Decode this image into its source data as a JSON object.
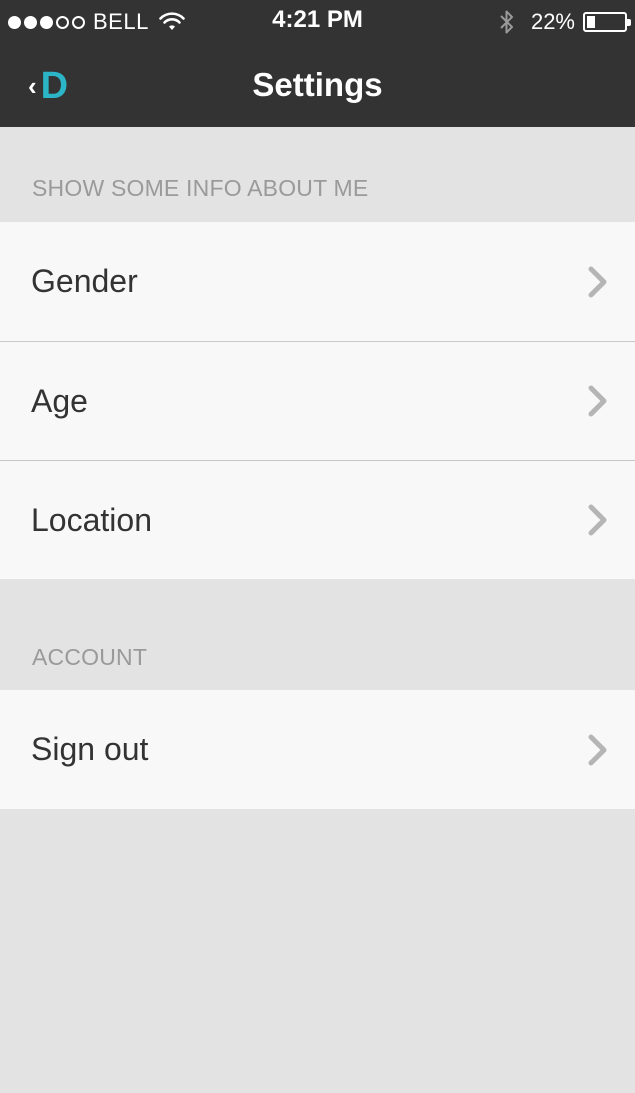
{
  "status_bar": {
    "carrier": "BELL",
    "signal_bars_filled": 3,
    "signal_bars_total": 5,
    "time": "4:21 PM",
    "battery_percent": "22%",
    "battery_level": 0.22
  },
  "nav": {
    "back_logo": "D",
    "title": "Settings"
  },
  "sections": [
    {
      "header": "SHOW SOME INFO ABOUT ME",
      "items": [
        {
          "label": "Gender"
        },
        {
          "label": "Age"
        },
        {
          "label": "Location"
        }
      ]
    },
    {
      "header": "ACCOUNT",
      "items": [
        {
          "label": "Sign out"
        }
      ]
    }
  ],
  "colors": {
    "nav_background": "#333333",
    "accent": "#2bb5c7",
    "page_background": "#e3e3e3",
    "row_background": "#f8f8f8"
  }
}
